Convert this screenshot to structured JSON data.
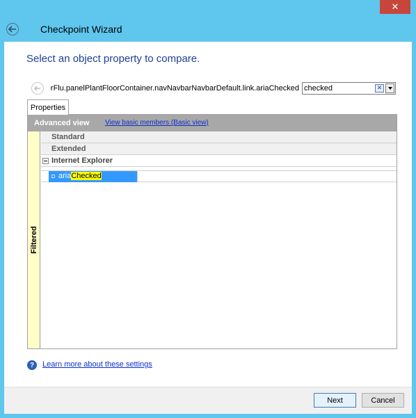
{
  "window": {
    "close_glyph": "✕",
    "back_icon": "back-arrow-icon",
    "title": "Checkpoint Wizard"
  },
  "main": {
    "heading": "Select an object property to compare.",
    "object_path": "ntainerFlu.panelPlantFloorContainer.navNavbarNavbarDefault.link.ariaChecked",
    "search": {
      "value": "checked",
      "clear_glyph": "✕"
    }
  },
  "properties_tab": {
    "label": "Properties"
  },
  "grid": {
    "header_title": "Advanced view",
    "basic_view_link": "View basic members (Basic view)",
    "side_label": "Filtered",
    "categories": [
      {
        "label": "Standard"
      },
      {
        "label": "Extended"
      },
      {
        "label": "Internet Explorer"
      }
    ],
    "selected_property": {
      "prefix": "aria",
      "match": "Checked"
    }
  },
  "footer": {
    "help_link": "Learn more about these settings",
    "next_label": "Next",
    "cancel_label": "Cancel"
  },
  "colors": {
    "chrome": "#5fc6ee",
    "close": "#c7463c",
    "heading": "#1e3f93",
    "selection": "#3399ff",
    "highlight": "#ffff00",
    "filtered_strip": "#fffec8",
    "link": "#0b2fcc"
  }
}
